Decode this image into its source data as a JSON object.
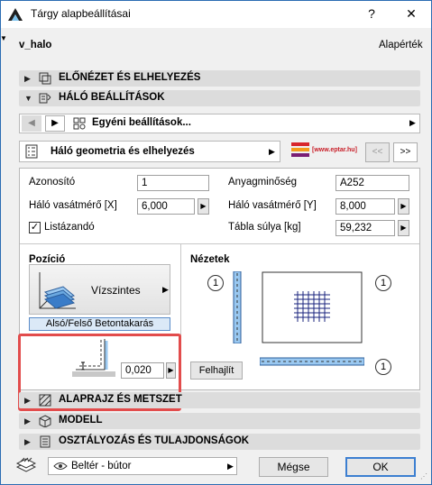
{
  "window": {
    "title": "Tárgy alapbeállításai",
    "help": "?",
    "close": "✕"
  },
  "header": {
    "object_name": "v_halo",
    "default_label": "Alapérték"
  },
  "sections": {
    "preview": "ELŐNÉZET ÉS ELHELYEZÉS",
    "mesh_settings": "HÁLÓ BEÁLLÍTÁSOK",
    "floorplan": "ALAPRAJZ ÉS METSZET",
    "model": "MODELL",
    "classification": "OSZTÁLYOZÁS ÉS TULAJDONSÁGOK"
  },
  "custom_bar": {
    "label": "Egyéni beállítások..."
  },
  "page_bar": {
    "label": "Háló geometria és elhelyezés",
    "logo_text": "[www.eptar.hu]",
    "prev": "<<",
    "next": ">>"
  },
  "fields": {
    "id_label": "Azonosító",
    "id_value": "1",
    "material_label": "Anyagminőség",
    "material_value": "A252",
    "diam_x_label": "Háló vasátmérő [X]",
    "diam_x_value": "6,000",
    "diam_y_label": "Háló vasátmérő [Y]",
    "diam_y_value": "8,000",
    "listable_label": "Listázandó",
    "listable_checked": true,
    "weight_label": "Tábla súlya [kg]",
    "weight_value": "59,232"
  },
  "position": {
    "title": "Pozíció",
    "orientation": "Vízszintes",
    "cover_label": "Alsó/Felső Betontakarás",
    "cover_value": "0,020"
  },
  "views": {
    "title": "Nézetek",
    "badge": "1",
    "bend_button": "Felhajlít"
  },
  "footer": {
    "layer": "Beltér - bútor",
    "cancel": "Mégse",
    "ok": "OK"
  }
}
